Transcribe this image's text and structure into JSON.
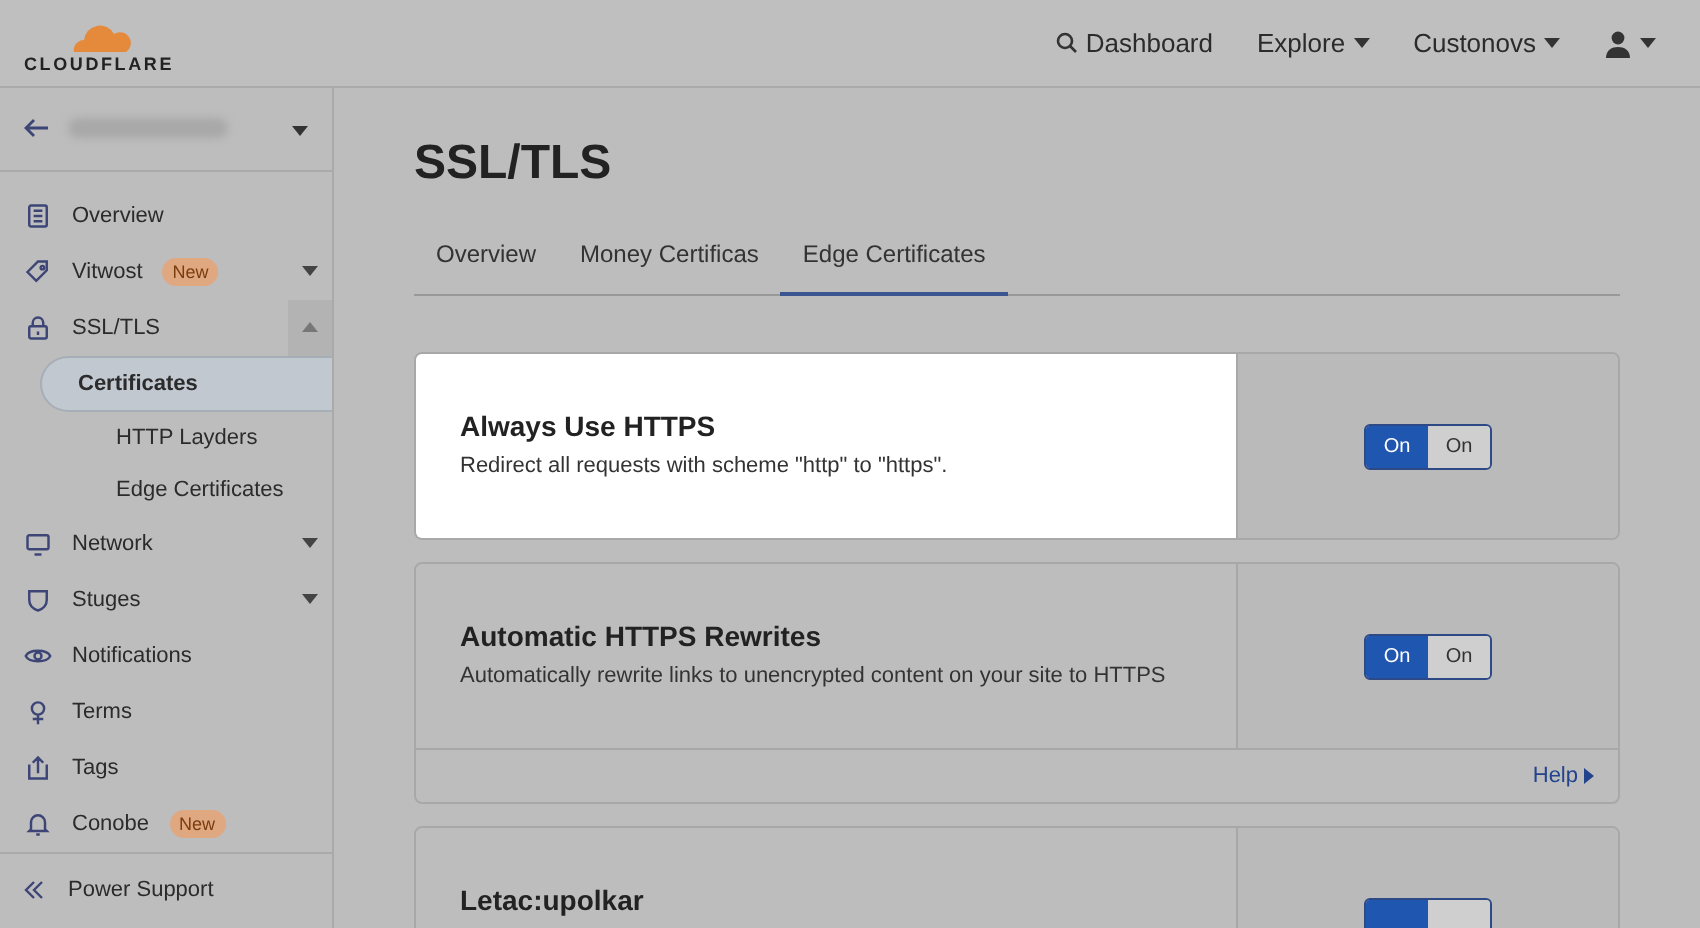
{
  "topbar": {
    "logo": "CLOUDFLARE",
    "nav": [
      {
        "label": "Dashboard",
        "kind": "search"
      },
      {
        "label": "Explore",
        "kind": "menu"
      },
      {
        "label": "Custonovs",
        "kind": "menu"
      }
    ]
  },
  "sidebar": {
    "items": [
      {
        "label": "Overview",
        "kind": "link"
      },
      {
        "label": "Vitwost",
        "kind": "menu",
        "expanded": false,
        "badge": "New"
      },
      {
        "label": "SSL/TLS",
        "kind": "menu",
        "expanded": true,
        "children": [
          {
            "label": "Certificates",
            "selected": true
          },
          {
            "label": "HTTP Layders",
            "selected": false
          },
          {
            "label": "Edge Certificates",
            "selected": false
          }
        ]
      },
      {
        "label": "Network",
        "kind": "menu",
        "expanded": false
      },
      {
        "label": "Stuges",
        "kind": "menu",
        "expanded": false
      },
      {
        "label": "Notifications",
        "kind": "link"
      },
      {
        "label": "Terms",
        "kind": "link"
      },
      {
        "label": "Tags",
        "kind": "link"
      },
      {
        "label": "Conobe",
        "kind": "link",
        "badge": "New"
      }
    ],
    "footer": "Power Support"
  },
  "page": {
    "title": "SSL/TLS",
    "tabs": [
      {
        "label": "Overview",
        "selected": false
      },
      {
        "label": "Money Certificas",
        "selected": false
      },
      {
        "label": "Edge Certificates",
        "selected": true
      }
    ],
    "cards": [
      {
        "title": "Always Use HTTPS",
        "description": "Redirect all requests with scheme \"http\" to \"https\".",
        "highlighted": true,
        "toggle": [
          {
            "label": "On",
            "selected": true
          },
          {
            "label": "On",
            "selected": false
          }
        ]
      },
      {
        "title": "Automatic HTTPS Rewrites",
        "description": "Automatically rewrite links to unencrypted content on your site to HTTPS",
        "highlighted": false,
        "toggle": [
          {
            "label": "On",
            "selected": true
          },
          {
            "label": "On",
            "selected": false
          }
        ],
        "help": "Help"
      },
      {
        "title": "Letac:upolkar",
        "highlighted": false,
        "toggle": [
          {
            "selected": true
          },
          {
            "selected": false
          }
        ]
      }
    ]
  }
}
